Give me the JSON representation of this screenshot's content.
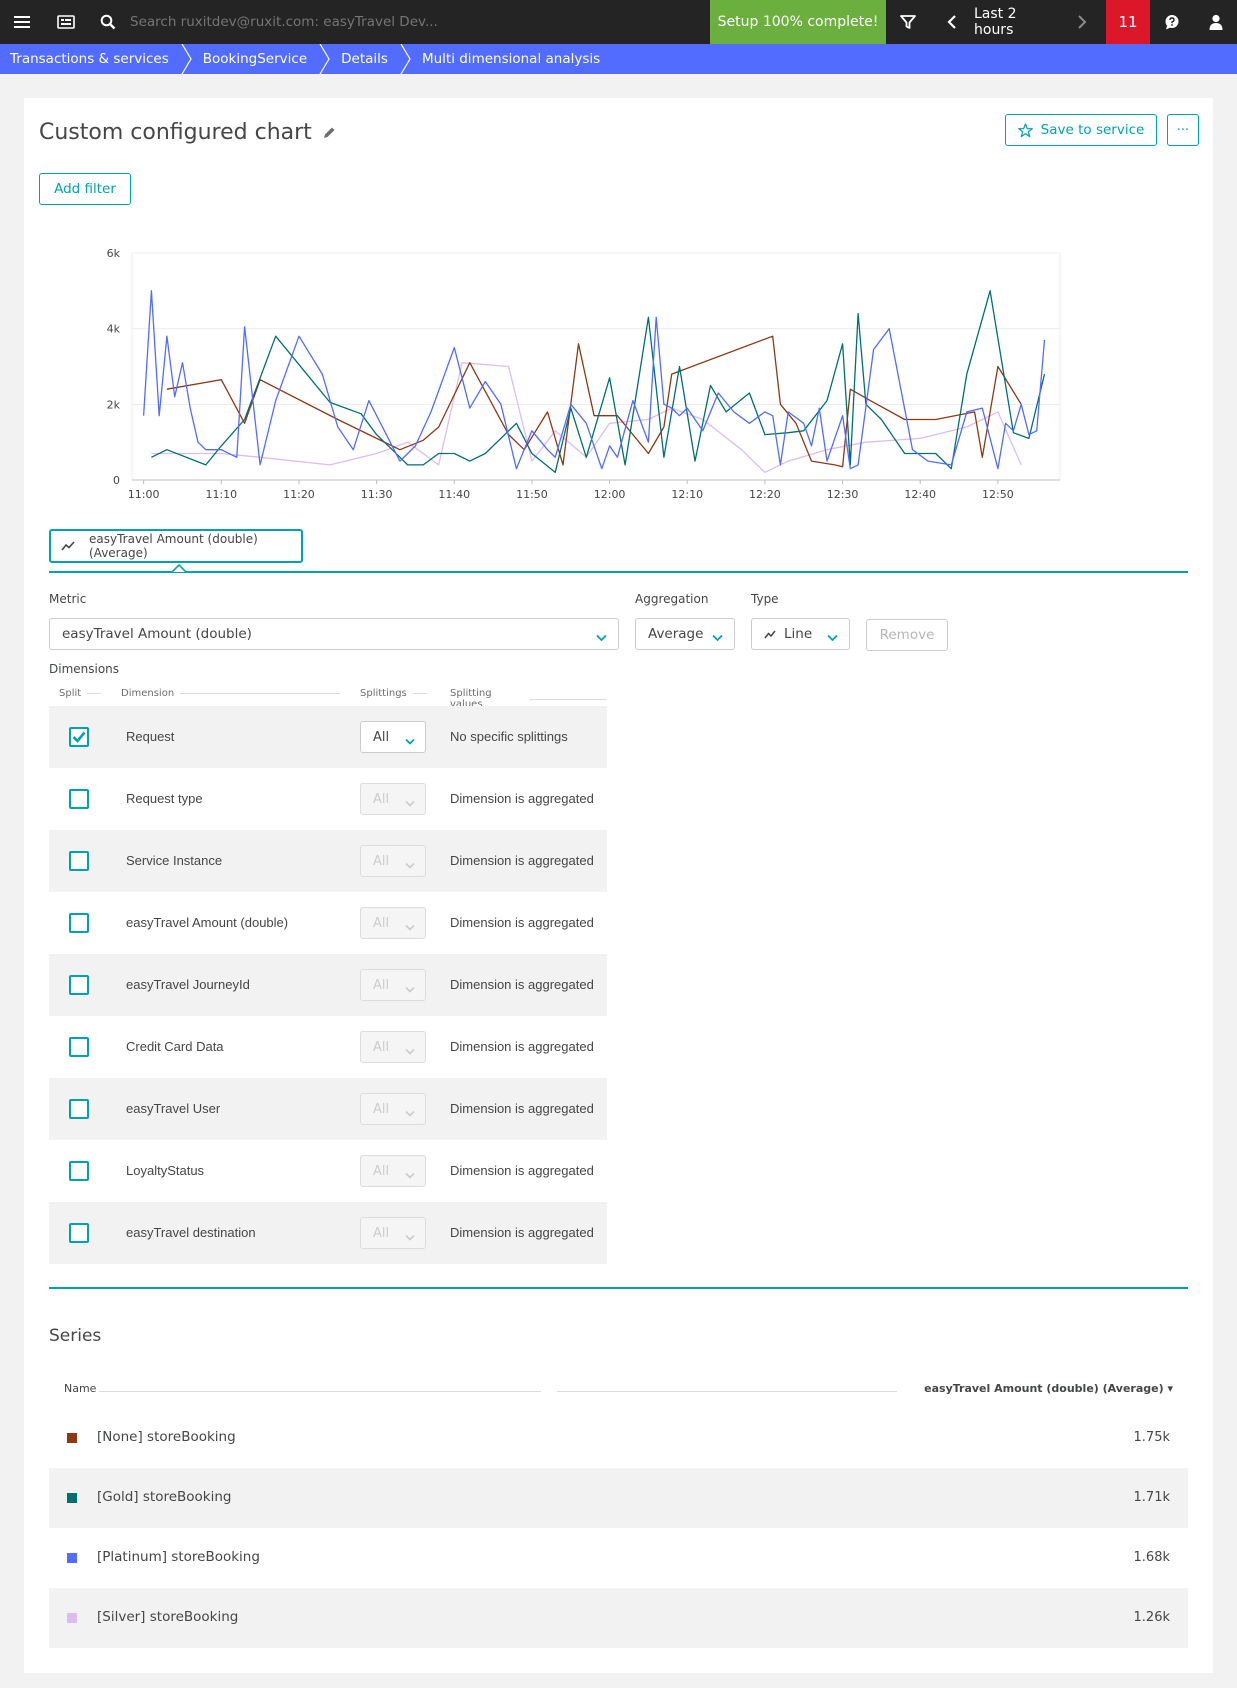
{
  "topbar": {
    "search_placeholder": "Search ruxitdev@ruxit.com: easyTravel Dev...",
    "setup_label": "Setup 100% complete!",
    "timeframe": "Last 2 hours",
    "alert_count": "11",
    "setup_color": "#6bb03f",
    "alert_color": "#dc172a"
  },
  "breadcrumb": {
    "items": [
      "Transactions & services",
      "BookingService",
      "Details",
      "Multi dimensional analysis"
    ],
    "color": "#526cff"
  },
  "page": {
    "title": "Custom configured chart",
    "save_label": "Save to service",
    "more_label": "···",
    "add_filter_label": "Add filter"
  },
  "metric_tab": {
    "label": "easyTravel Amount (double) (Average)"
  },
  "config": {
    "metric_label": "Metric",
    "metric_value": "easyTravel Amount (double)",
    "aggregation_label": "Aggregation",
    "aggregation_value": "Average",
    "type_label": "Type",
    "type_value": "Line",
    "remove_label": "Remove"
  },
  "dimensions": {
    "title": "Dimensions",
    "headers": {
      "split": "Split",
      "dimension": "Dimension",
      "splittings": "Splittings",
      "values": "Splitting values"
    },
    "rows": [
      {
        "name": "Request",
        "checked": true,
        "splitting": "All",
        "value": "No specific splittings"
      },
      {
        "name": "Request type",
        "checked": false,
        "splitting": "All",
        "value": "Dimension is aggregated"
      },
      {
        "name": "Service Instance",
        "checked": false,
        "splitting": "All",
        "value": "Dimension is aggregated"
      },
      {
        "name": "easyTravel Amount (double)",
        "checked": false,
        "splitting": "All",
        "value": "Dimension is aggregated"
      },
      {
        "name": "easyTravel JourneyId",
        "checked": false,
        "splitting": "All",
        "value": "Dimension is aggregated"
      },
      {
        "name": "Credit Card Data",
        "checked": false,
        "splitting": "All",
        "value": "Dimension is aggregated"
      },
      {
        "name": "easyTravel User",
        "checked": false,
        "splitting": "All",
        "value": "Dimension is aggregated"
      },
      {
        "name": "LoyaltyStatus",
        "checked": false,
        "splitting": "All",
        "value": "Dimension is aggregated"
      },
      {
        "name": "easyTravel destination",
        "checked": false,
        "splitting": "All",
        "value": "Dimension is aggregated"
      }
    ]
  },
  "series_table": {
    "title": "Series",
    "name_header": "Name",
    "value_header": "easyTravel Amount (double) (Average) ▾",
    "rows": [
      {
        "name": "[None] storeBooking",
        "value": "1.75k",
        "color": "#8b3a14"
      },
      {
        "name": "[Gold] storeBooking",
        "value": "1.71k",
        "color": "#006f6f"
      },
      {
        "name": "[Platinum] storeBooking",
        "value": "1.68k",
        "color": "#526cff"
      },
      {
        "name": "[Silver] storeBooking",
        "value": "1.26k",
        "color": "#dcbdf0"
      }
    ]
  },
  "chart_data": {
    "type": "line",
    "x_ticks": [
      "11:00",
      "11:10",
      "11:20",
      "11:30",
      "11:40",
      "11:50",
      "12:00",
      "12:10",
      "12:20",
      "12:30",
      "12:40",
      "12:50"
    ],
    "y_ticks": [
      "0",
      "2k",
      "4k",
      "6k"
    ],
    "ylim": [
      0,
      6000
    ],
    "grid": true,
    "series": [
      {
        "name": "[None] storeBooking",
        "color": "#8b3a14",
        "x": [
          "11:03",
          "11:10",
          "11:13",
          "11:15",
          "11:25",
          "11:33",
          "11:36",
          "11:38",
          "11:42",
          "11:47",
          "11:49",
          "11:52",
          "11:54",
          "11:56",
          "11:58",
          "12:01",
          "12:05",
          "12:07",
          "12:08",
          "12:21",
          "12:22",
          "12:24",
          "12:26",
          "12:29",
          "12:30",
          "12:31",
          "12:34",
          "12:38",
          "12:42",
          "12:47",
          "12:48",
          "12:50",
          "12:53"
        ],
        "y": [
          2400,
          2650,
          1500,
          2650,
          1600,
          800,
          1050,
          1400,
          3100,
          1200,
          800,
          1800,
          400,
          3600,
          1700,
          1700,
          700,
          1400,
          2800,
          3800,
          2000,
          1500,
          500,
          400,
          350,
          2400,
          2050,
          1600,
          1600,
          1800,
          600,
          3000,
          2000
        ]
      },
      {
        "name": "[Gold] storeBooking",
        "color": "#006f6f",
        "x": [
          "11:01",
          "11:03",
          "11:08",
          "11:10",
          "11:13",
          "11:17",
          "11:24",
          "11:28",
          "11:30",
          "11:32",
          "11:34",
          "11:36",
          "11:38",
          "11:40",
          "11:42",
          "11:44",
          "11:48",
          "11:50",
          "11:53",
          "11:55",
          "11:57",
          "12:00",
          "12:02",
          "12:05",
          "12:07",
          "12:09",
          "12:11",
          "12:13",
          "12:15",
          "12:18",
          "12:20",
          "12:23",
          "12:25",
          "12:28",
          "12:30",
          "12:31",
          "12:32",
          "12:33",
          "12:35",
          "12:38",
          "12:42",
          "12:44",
          "12:46",
          "12:49",
          "12:52",
          "12:54",
          "12:56"
        ],
        "y": [
          600,
          800,
          400,
          900,
          1600,
          3800,
          2050,
          1750,
          1200,
          800,
          400,
          400,
          700,
          700,
          500,
          700,
          1500,
          700,
          200,
          1900,
          600,
          2700,
          400,
          4300,
          600,
          3000,
          500,
          2500,
          1800,
          2300,
          1200,
          1250,
          1300,
          2100,
          3600,
          400,
          4400,
          2000,
          1600,
          700,
          700,
          300,
          2800,
          5000,
          1250,
          1100,
          2800
        ]
      },
      {
        "name": "[Platinum] storeBooking",
        "color": "#526cff",
        "x": [
          "11:00",
          "11:01",
          "11:02",
          "11:03",
          "11:04",
          "11:05",
          "11:06",
          "11:07",
          "11:08",
          "11:10",
          "11:12",
          "11:13",
          "11:15",
          "11:17",
          "11:20",
          "11:23",
          "11:25",
          "11:27",
          "11:29",
          "11:31",
          "11:33",
          "11:35",
          "11:37",
          "11:40",
          "11:42",
          "11:44",
          "11:46",
          "11:48",
          "11:50",
          "11:52",
          "11:53",
          "11:55",
          "11:57",
          "11:59",
          "12:00",
          "12:01",
          "12:03",
          "12:05",
          "12:06",
          "12:07",
          "12:08",
          "12:09",
          "12:10",
          "12:12",
          "12:14",
          "12:16",
          "12:18",
          "12:20",
          "12:21",
          "12:22",
          "12:23",
          "12:25",
          "12:26",
          "12:27",
          "12:28",
          "12:30",
          "12:31",
          "12:32",
          "12:34",
          "12:36",
          "12:39",
          "12:41",
          "12:44",
          "12:46",
          "12:48",
          "12:50",
          "12:51",
          "12:52",
          "12:53",
          "12:54",
          "12:55",
          "12:56"
        ],
        "y": [
          1700,
          5000,
          1700,
          3800,
          2200,
          3100,
          1900,
          1000,
          800,
          800,
          600,
          4050,
          400,
          2100,
          3800,
          2800,
          1400,
          800,
          2100,
          1300,
          500,
          900,
          1800,
          3500,
          1900,
          2600,
          2000,
          300,
          1300,
          800,
          600,
          2000,
          1500,
          300,
          900,
          600,
          2100,
          1000,
          4300,
          2000,
          1900,
          1700,
          1900,
          1300,
          2300,
          1800,
          1500,
          1800,
          1700,
          400,
          1800,
          1500,
          900,
          1900,
          500,
          1700,
          300,
          400,
          3450,
          4000,
          800,
          500,
          400,
          1800,
          1900,
          300,
          1500,
          1300,
          2000,
          1200,
          1300,
          3700
        ]
      },
      {
        "name": "[Silver] storeBooking",
        "color": "#dcbdf0",
        "x": [
          "11:01",
          "11:10",
          "11:15",
          "11:24",
          "11:30",
          "11:34",
          "11:38",
          "11:41",
          "11:47",
          "11:50",
          "11:53",
          "11:57",
          "12:00",
          "12:05",
          "12:08",
          "12:12",
          "12:17",
          "12:20",
          "12:23",
          "12:28",
          "12:33",
          "12:40",
          "12:46",
          "12:50",
          "12:53"
        ],
        "y": [
          700,
          700,
          600,
          400,
          700,
          1000,
          400,
          3100,
          3000,
          500,
          1300,
          600,
          1500,
          1600,
          1900,
          1600,
          800,
          200,
          500,
          800,
          1000,
          1100,
          1400,
          1800,
          400
        ]
      }
    ]
  }
}
